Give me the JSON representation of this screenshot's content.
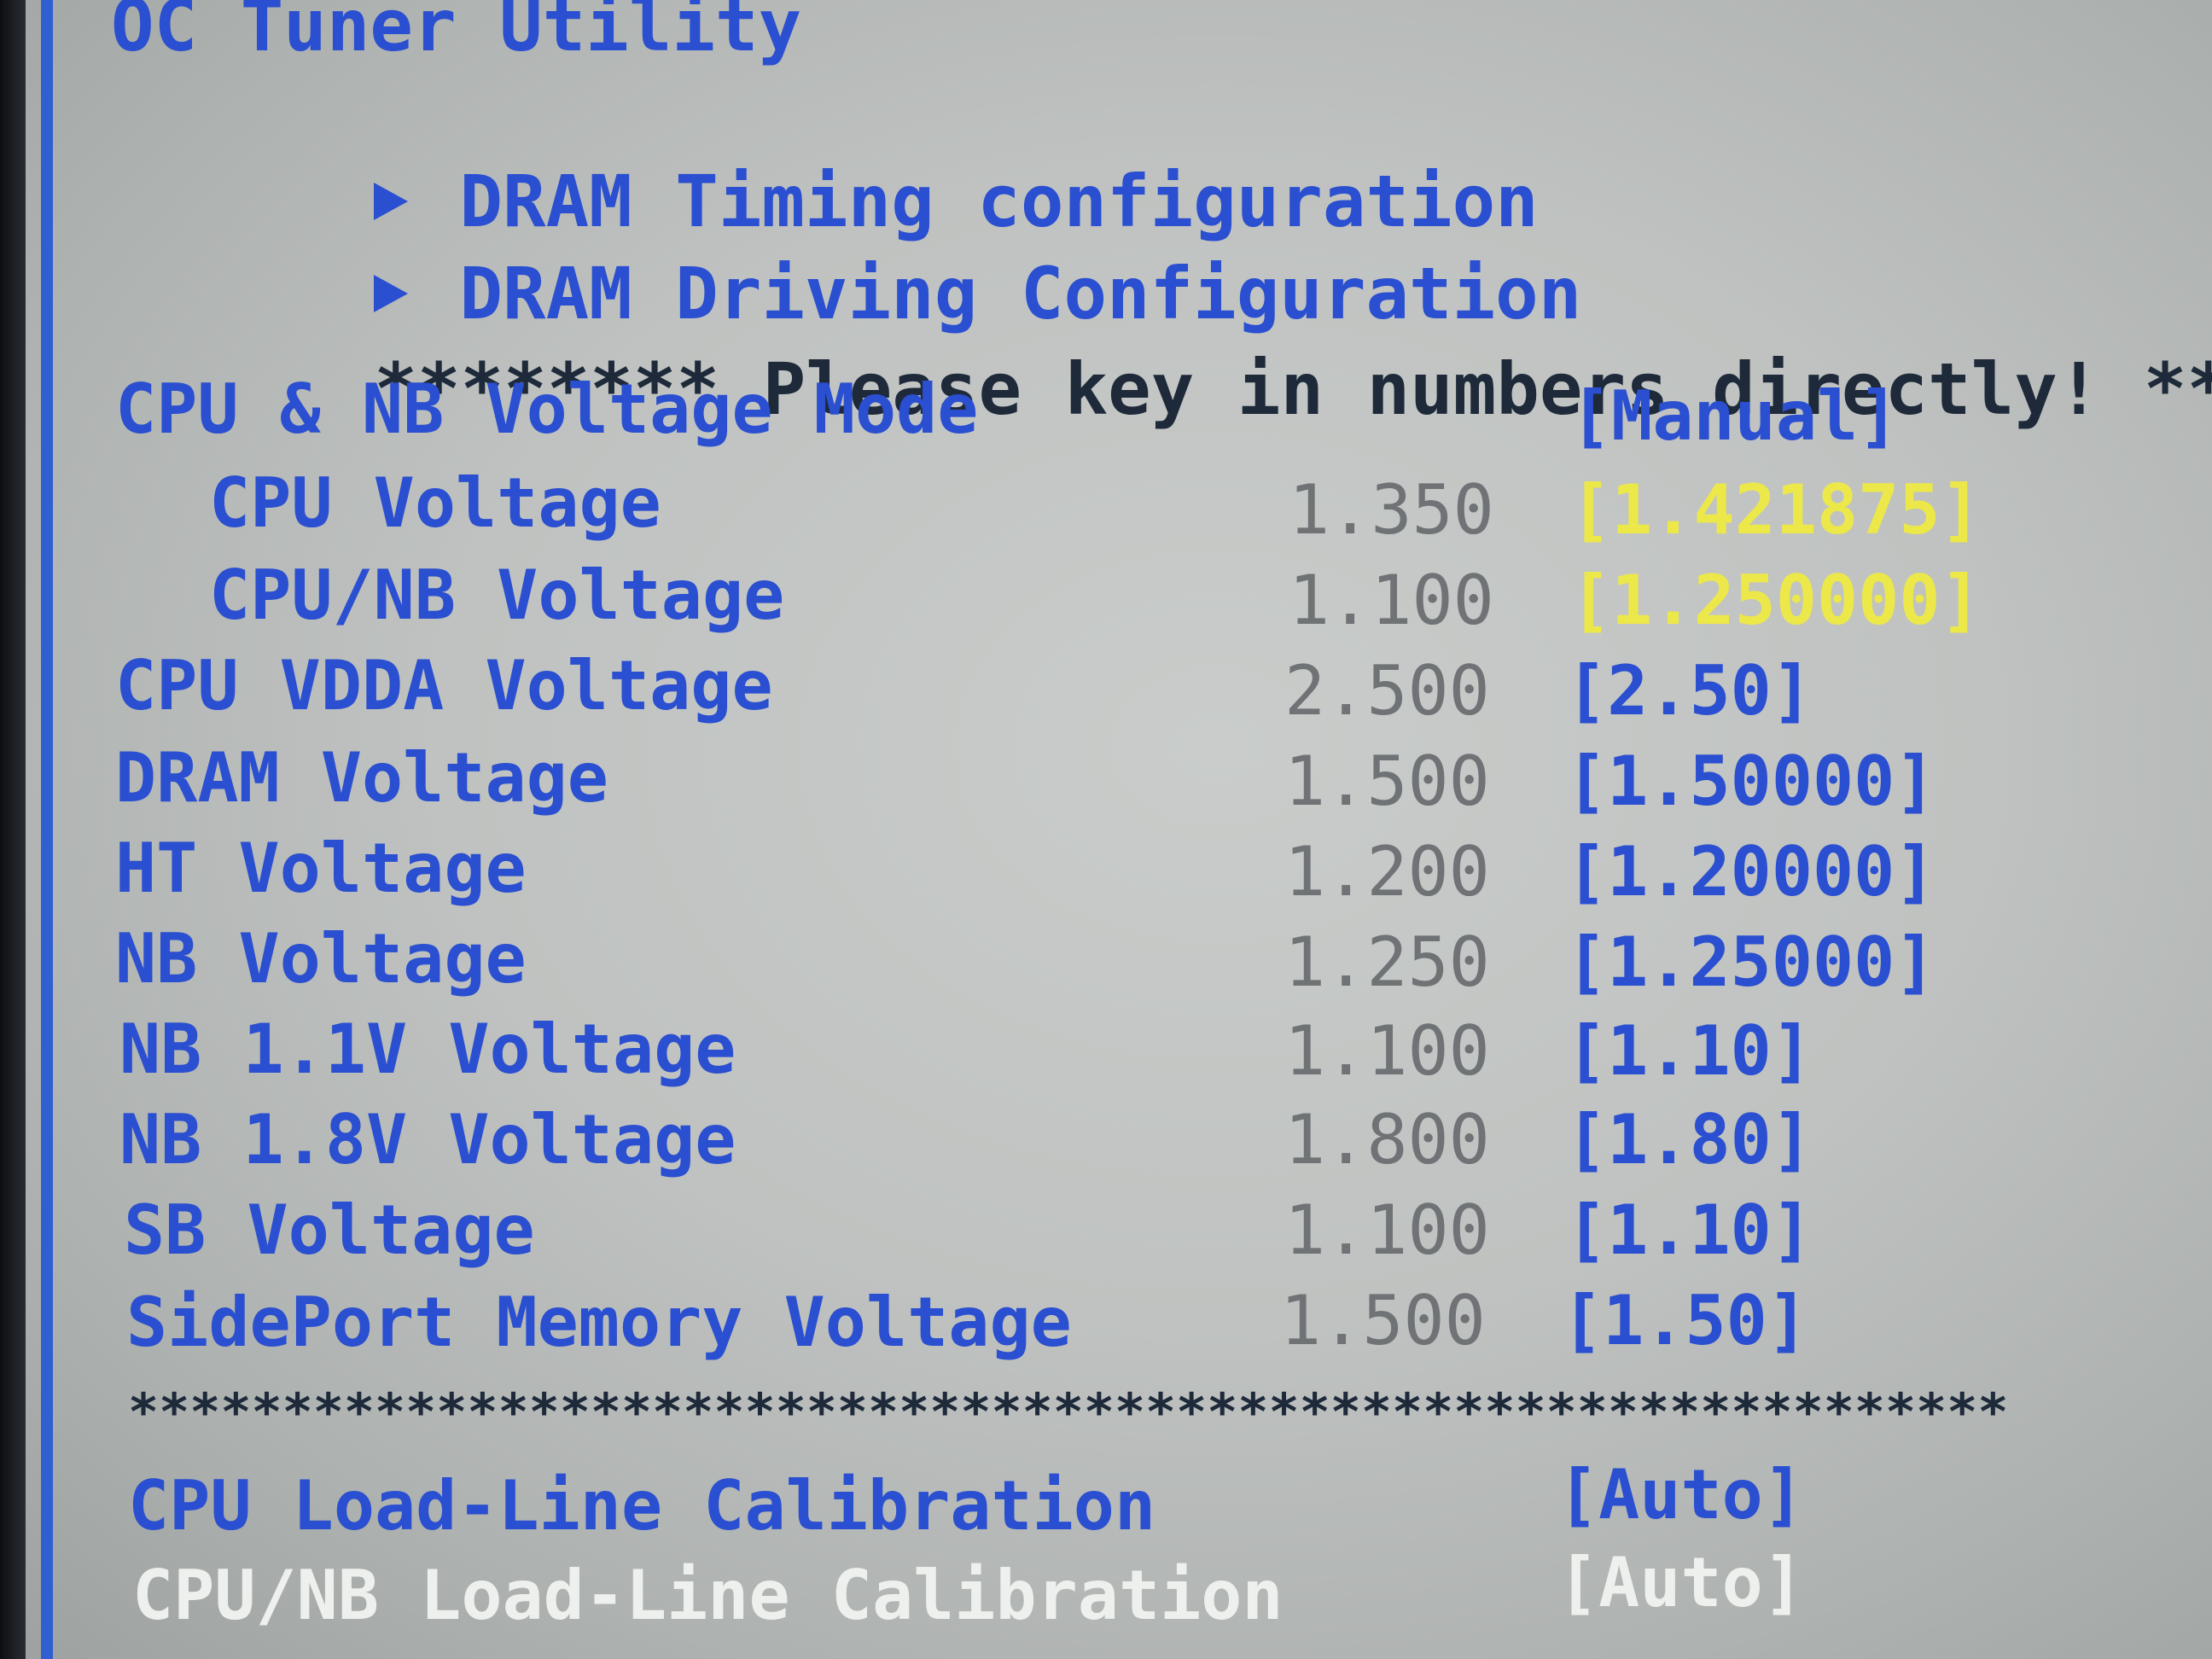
{
  "title": "OC Tuner Utility",
  "submenus": [
    {
      "label": "DRAM Timing configuration",
      "icon": "triangle-right-icon"
    },
    {
      "label": "DRAM Driving Configuration",
      "icon": "triangle-right-icon"
    }
  ],
  "notice": {
    "prefix": "********",
    "text": "Please key in numbers directly!",
    "suffix": "******"
  },
  "mode": {
    "label": "CPU & NB Voltage Mode",
    "value": "[Manual]"
  },
  "voltages": [
    {
      "label": "CPU Voltage",
      "current": "1.350",
      "value": "[1.421875]"
    },
    {
      "label": "CPU/NB Voltage",
      "current": "1.100",
      "value": "[1.250000]"
    },
    {
      "label": "CPU VDDA Voltage",
      "current": "2.500",
      "value": "[2.50]"
    },
    {
      "label": "DRAM Voltage",
      "current": "1.500",
      "value": "[1.50000]"
    },
    {
      "label": "HT Voltage",
      "current": "1.200",
      "value": "[1.20000]"
    },
    {
      "label": "NB Voltage",
      "current": "1.250",
      "value": "[1.25000]"
    },
    {
      "label": "NB 1.1V Voltage",
      "current": "1.100",
      "value": "[1.10]"
    },
    {
      "label": "NB 1.8V Voltage",
      "current": "1.800",
      "value": "[1.80]"
    },
    {
      "label": "SB Voltage",
      "current": "1.100",
      "value": "[1.10]"
    },
    {
      "label": "SidePort Memory Voltage",
      "current": "1.500",
      "value": "[1.50]"
    }
  ],
  "separator": "*************************************************************",
  "llc": [
    {
      "label": "CPU Load-Line Calibration",
      "value": "[Auto]"
    },
    {
      "label": "CPU/NB Load-Line Calibration",
      "value": "[Auto]"
    }
  ],
  "colors": {
    "label_blue": "#2a4fd0",
    "selected_yellow": "#ece84a",
    "highlight_white": "#eef0ee",
    "current_grey": "#6f7375"
  }
}
